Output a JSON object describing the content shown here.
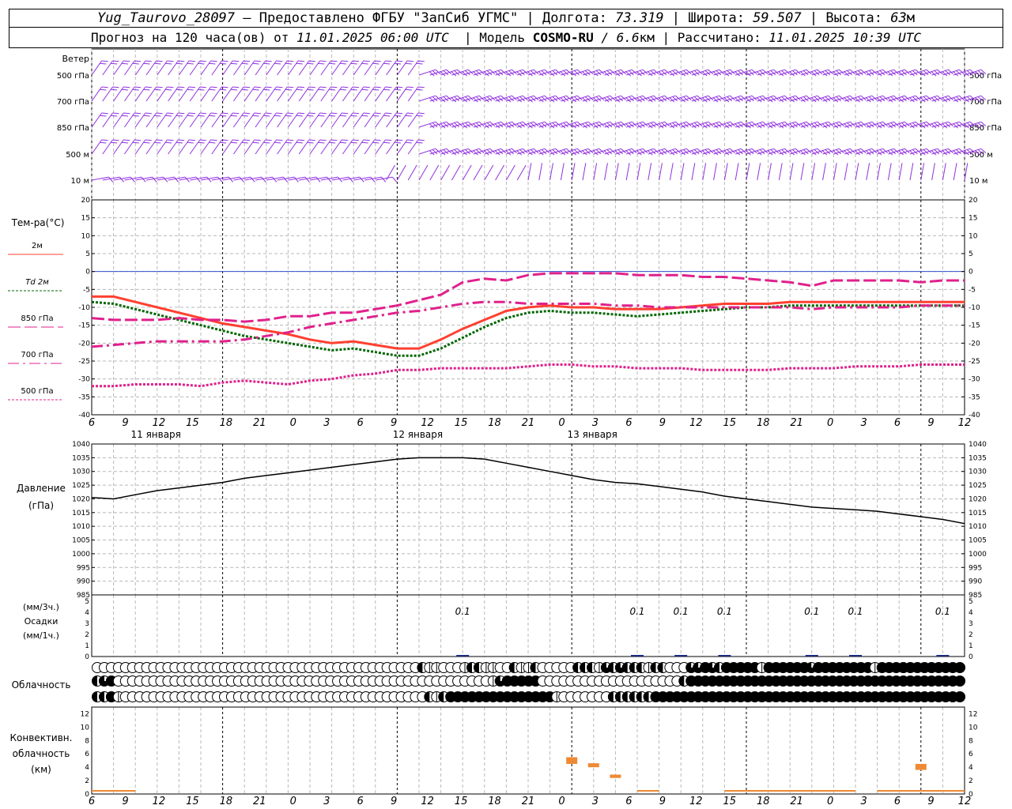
{
  "header": {
    "station": "Yug_Taurovo_28097",
    "provided_by": "– Предоставлено ФГБУ \"ЗапСиб УГМС\"",
    "lon_label": "Долгота:",
    "lon_value": "73.319",
    "lat_label": "Широта:",
    "lat_value": "59.507",
    "alt_label": "Высота:",
    "alt_value": "63",
    "alt_unit": "м",
    "forecast_prefix": "Прогноз на 120 часа(ов) от",
    "forecast_start": "11.01.2025 06:00 UTC",
    "model_label": "Модель",
    "model_name": "COSMO-RU",
    "model_res": "/ 6.6",
    "model_res_unit": "км",
    "calc_label": "Рассчитано:",
    "calc_time": "11.01.2025 10:39 UTC"
  },
  "chart_data": [
    {
      "type": "barbs",
      "title": "Ветер",
      "levels": [
        "500 гПа",
        "700 гПа",
        "850 гПа",
        "500 м",
        "10  м"
      ],
      "x_hours_from_start": [
        0,
        120
      ]
    },
    {
      "type": "line",
      "ylabel": "Тем-ра(°C)",
      "ylim": [
        -40,
        20
      ],
      "yticks": [
        20,
        15,
        10,
        5,
        0,
        -5,
        -10,
        -15,
        -20,
        -25,
        -30,
        -35,
        -40
      ],
      "x": [
        0,
        3,
        6,
        9,
        12,
        15,
        18,
        21,
        24,
        27,
        30,
        33,
        36,
        39,
        42,
        45,
        48,
        51,
        54,
        57,
        60,
        63,
        66,
        69,
        72,
        75,
        78,
        81,
        84,
        87,
        90,
        93,
        96,
        99,
        102,
        105,
        108,
        111,
        114,
        117,
        120
      ],
      "series": [
        {
          "name": "2м",
          "color": "#ff4030",
          "style": "solid",
          "values": [
            -7,
            -7,
            -8.5,
            -10,
            -11.5,
            -13,
            -14.5,
            -15.5,
            -16.5,
            -17.5,
            -19,
            -20,
            -19.5,
            -20.5,
            -21.5,
            -21.5,
            -19,
            -16,
            -13.5,
            -11,
            -10,
            -9.5,
            -10,
            -10,
            -10.5,
            -10.5,
            -10.5,
            -10,
            -9.5,
            -9,
            -9,
            -9,
            -8.5,
            -8.5,
            -8.5,
            -8.5,
            -8.5,
            -8.5,
            -8.5,
            -8.5,
            -8.5
          ]
        },
        {
          "name": "Td  2м",
          "color": "#006600",
          "style": "dotted",
          "values": [
            -8.5,
            -9,
            -10.5,
            -12,
            -13.5,
            -15,
            -16.5,
            -18,
            -19,
            -20,
            -21,
            -22,
            -21.5,
            -22.5,
            -23.5,
            -23.5,
            -21.5,
            -18.5,
            -15.5,
            -13,
            -11.5,
            -11,
            -11.5,
            -11.5,
            -12,
            -12.5,
            -12,
            -11.5,
            -11,
            -10.5,
            -10,
            -10,
            -9.5,
            -9.5,
            -9.5,
            -9.5,
            -9.5,
            -9.5,
            -9.5,
            -9.5,
            -9.5
          ]
        },
        {
          "name": "850 гПа",
          "color": "#e0208c",
          "style": "longdash",
          "values": [
            -13,
            -13.5,
            -13.5,
            -13.5,
            -13,
            -13.5,
            -13.5,
            -14,
            -13.5,
            -12.5,
            -12.5,
            -11.5,
            -11.5,
            -10.5,
            -9.5,
            -8,
            -6.5,
            -3,
            -2,
            -2.5,
            -1,
            -0.5,
            -0.5,
            -0.5,
            -0.5,
            -1,
            -1,
            -1,
            -1.5,
            -1.5,
            -2,
            -2.5,
            -3,
            -4,
            -2.5,
            -2.5,
            -2.5,
            -2.5,
            -3,
            -2.5,
            -2.5
          ]
        },
        {
          "name": "700 гПа",
          "color": "#e0208c",
          "style": "dashdot",
          "values": [
            -21,
            -20.5,
            -20,
            -19.5,
            -19.5,
            -19.5,
            -19.5,
            -19,
            -18,
            -17,
            -15.5,
            -14.5,
            -13.5,
            -12.5,
            -11.5,
            -11,
            -10,
            -9,
            -8.5,
            -8.5,
            -9,
            -9,
            -9,
            -9,
            -9.5,
            -9.5,
            -10,
            -10,
            -10,
            -10,
            -10,
            -10,
            -10,
            -10.5,
            -10,
            -10,
            -10,
            -10,
            -9.5,
            -9.5,
            -9.5
          ]
        },
        {
          "name": "500 гПа",
          "color": "#e0208c",
          "style": "dotted",
          "values": [
            -32,
            -32,
            -31.5,
            -31.5,
            -31.5,
            -32,
            -31,
            -30.5,
            -31,
            -31.5,
            -30.5,
            -30,
            -29,
            -28.5,
            -27.5,
            -27.5,
            -27,
            -27,
            -27,
            -27,
            -26.5,
            -26,
            -26,
            -26.5,
            -26.5,
            -27,
            -27,
            -27,
            -27.5,
            -27.5,
            -27.5,
            -27.5,
            -27,
            -27,
            -27,
            -26.5,
            -26.5,
            -26.5,
            -26,
            -26,
            -26
          ]
        }
      ]
    },
    {
      "type": "line",
      "ylabel": "Давление",
      "yunit": "(гПа)",
      "ylim": [
        985,
        1040
      ],
      "yticks": [
        1040,
        1035,
        1030,
        1025,
        1020,
        1015,
        1010,
        1005,
        1000,
        995,
        990,
        985
      ],
      "x": [
        0,
        3,
        6,
        9,
        12,
        15,
        18,
        21,
        24,
        27,
        30,
        33,
        36,
        39,
        42,
        45,
        48,
        51,
        54,
        57,
        60,
        63,
        66,
        69,
        72,
        75,
        78,
        81,
        84,
        87,
        90,
        93,
        96,
        99,
        102,
        105,
        108,
        111,
        114,
        117,
        120
      ],
      "series": [
        {
          "name": "",
          "color": "#000000",
          "values": [
            1020.5,
            1020,
            1021.5,
            1023,
            1024,
            1025,
            1026,
            1027.5,
            1028.5,
            1029.5,
            1030.5,
            1031.5,
            1032.5,
            1033.5,
            1034.5,
            1035,
            1035,
            1035,
            1034.5,
            1033,
            1031.5,
            1030,
            1028.5,
            1027,
            1026,
            1025.5,
            1024.5,
            1023.5,
            1022.5,
            1021,
            1020,
            1019,
            1018,
            1017,
            1016.5,
            1016,
            1015.5,
            1014.5,
            1013.5,
            1012.5,
            1011
          ]
        }
      ]
    },
    {
      "type": "bar",
      "ylabel_top": "(мм/3ч.)",
      "ylabel": "Осадки",
      "ylabel_bottom": "(мм/1ч.)",
      "ylim": [
        0,
        5
      ],
      "yticks": [
        5,
        4,
        3,
        2,
        1,
        0
      ],
      "labels": [
        {
          "x": 51,
          "text": "0.1"
        },
        {
          "x": 75,
          "text": "0.1"
        },
        {
          "x": 81,
          "text": "0.1"
        },
        {
          "x": 87,
          "text": "0.1"
        },
        {
          "x": 99,
          "text": "0.1"
        },
        {
          "x": 105,
          "text": "0.1"
        },
        {
          "x": 117,
          "text": "0.1"
        }
      ]
    },
    {
      "type": "symbols",
      "ylabel": "Облачность",
      "rows": [
        "000000000000000000000000000000000000000000000021100012211002112000002221323222122000334324444414444443444444441444444444444",
        "234000000000000000000000000000000000000000000000000000001344444000000000000000000002444444444444444444444444444444444444444",
        "224100000000000000000000000000000000000000000002124444444444444441000000022222244444444444444444444444444444444444444444444"
      ]
    },
    {
      "type": "bar",
      "ylabel": "Конвективн.",
      "ylabel2": "облачность",
      "yunit": "(км)",
      "ylim": [
        0,
        13
      ],
      "yticks": [
        12,
        10,
        8,
        6,
        4,
        2,
        0
      ],
      "bars": [
        {
          "x": 66,
          "bottom": 4.5,
          "top": 5.5
        },
        {
          "x": 69,
          "bottom": 4,
          "top": 4.6
        },
        {
          "x": 72,
          "bottom": 2.4,
          "top": 2.9
        },
        {
          "x": 114,
          "bottom": 3.6,
          "top": 4.5
        }
      ]
    }
  ],
  "time_axis": {
    "hour_labels": [
      "6",
      "9",
      "12",
      "15",
      "18",
      "21",
      "0",
      "3",
      "6",
      "9",
      "12",
      "15",
      "18",
      "21",
      "0",
      "3",
      "6",
      "9",
      "12",
      "15",
      "18",
      "21",
      "0",
      "3",
      "6",
      "9",
      "12"
    ],
    "days": [
      {
        "label": "11 января",
        "hour": 6
      },
      {
        "label": "12 января",
        "hour": 42
      },
      {
        "label": "13 января",
        "hour": 66
      }
    ]
  },
  "colors": {
    "wind_barb": "#9030e0",
    "conv_bar": "#ee8a33",
    "conv_low": "#ee8a33",
    "precip": "#1a2a80",
    "zero_line": "#3050d0"
  }
}
